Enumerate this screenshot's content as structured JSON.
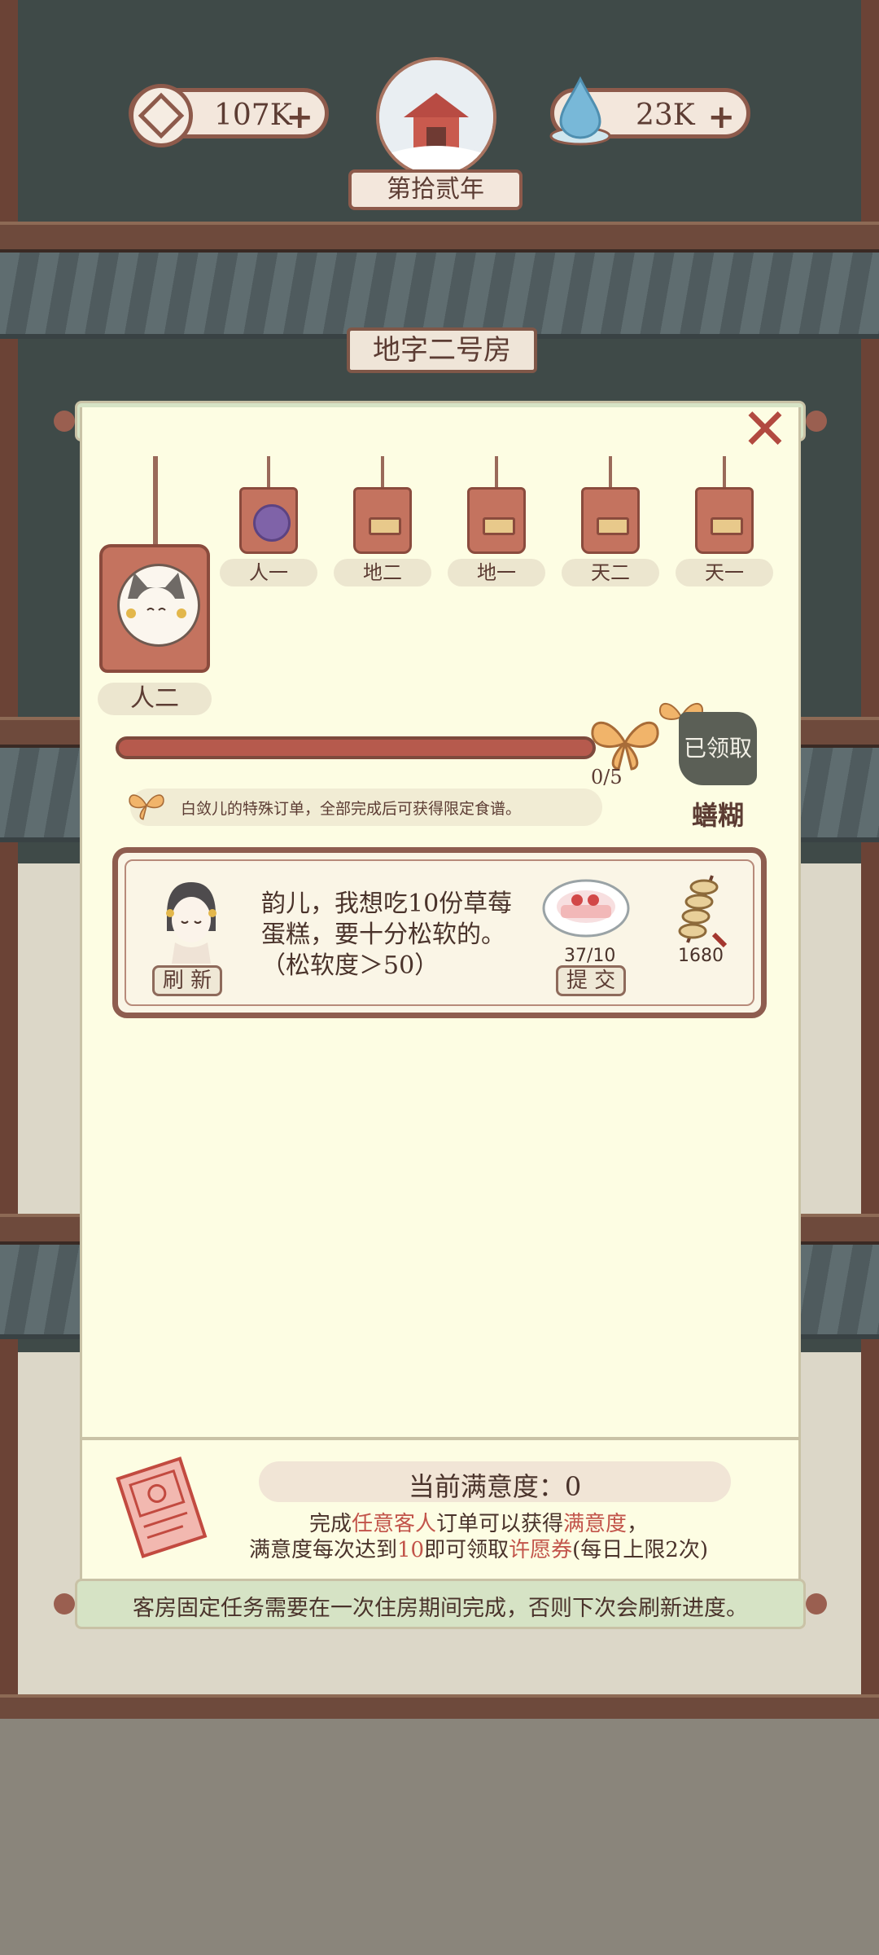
{
  "hud": {
    "coins": "107K",
    "coins_plus": "+",
    "water": "23K",
    "water_plus": "+",
    "year": "第拾贰年"
  },
  "room": {
    "title": "地字二号房"
  },
  "tags": {
    "current": "人二",
    "items": [
      {
        "label": "人一"
      },
      {
        "label": "地二"
      },
      {
        "label": "地一"
      },
      {
        "label": "天二"
      },
      {
        "label": "天一"
      }
    ]
  },
  "progress": {
    "current": 0,
    "total": 5,
    "text": "0/5",
    "claimed_label": "已领取",
    "reward_name": "蟮糊"
  },
  "hint": "白敛儿的特殊订单，全部完成后可获得限定食谱。",
  "order": {
    "text": "韵儿，我想吃10份草莓蛋糕，要十分松软的。（松软度＞50）",
    "refresh_label": "刷 新",
    "submit_label": "提 交",
    "item_count": "37/10",
    "reward_coins": "1680"
  },
  "footer": {
    "satisfaction": "当前满意度：0",
    "line1_a": "完成",
    "line1_b": "任意客人",
    "line1_c": "订单可以获得",
    "line1_d": "满意度",
    "line1_e": "，",
    "line2_a": "满意度每次达到",
    "line2_b": "10",
    "line2_c": "即可领取",
    "line2_d": "许愿券",
    "line2_e": "(每日上限2次)",
    "note": "客房固定任务需要在一次住房期间完成，否则下次会刷新进度。"
  },
  "colors": {
    "panel_bg": "#fdfde3",
    "accent_red": "#c2544a",
    "wood": "#8e5d4f"
  }
}
